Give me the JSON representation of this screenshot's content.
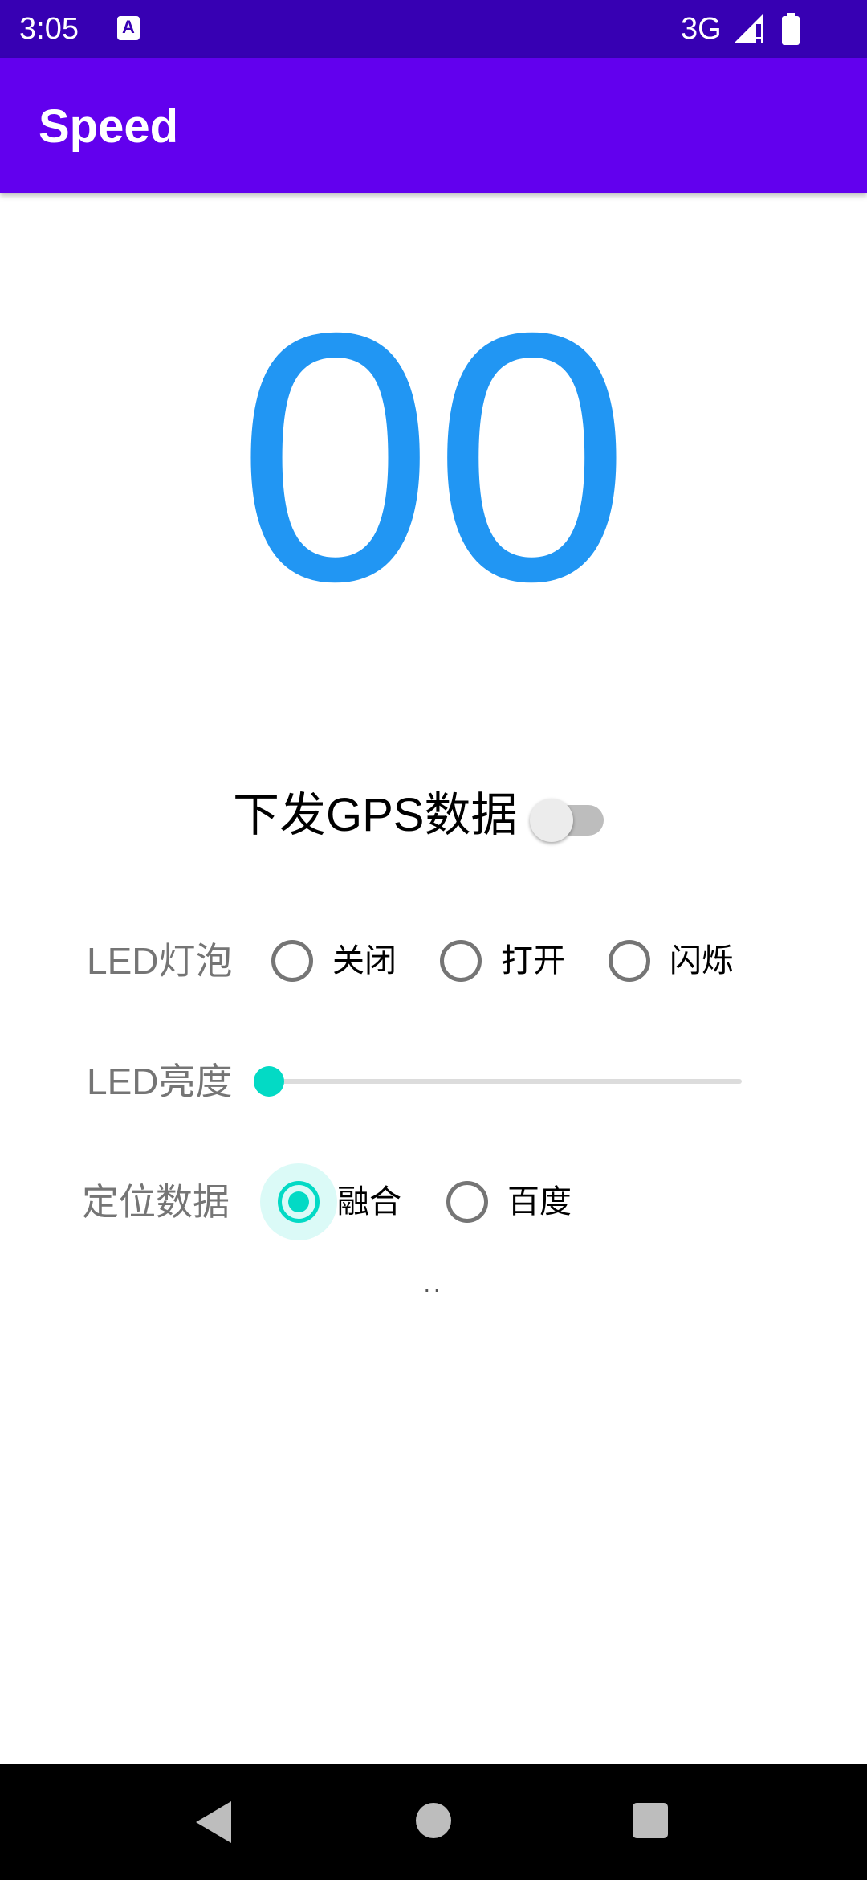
{
  "status_bar": {
    "time": "3:05",
    "notification_icon_letter": "A",
    "network_type": "3G",
    "icons": [
      "notification-icon",
      "signal-icon",
      "battery-icon"
    ]
  },
  "app_bar": {
    "title": "Speed"
  },
  "speed": {
    "value": "00"
  },
  "gps": {
    "label": "下发GPS数据",
    "enabled": false
  },
  "led_bulb": {
    "label": "LED灯泡",
    "options": [
      "关闭",
      "打开",
      "闪烁"
    ],
    "selected": null
  },
  "led_brightness": {
    "label": "LED亮度",
    "value": 0
  },
  "location_data": {
    "label": "定位数据",
    "options": [
      "融合",
      "百度"
    ],
    "selected": "融合"
  },
  "status_text": "..",
  "nav_bar": {
    "icons": [
      "back-icon",
      "home-icon",
      "recents-icon"
    ]
  },
  "colors": {
    "status_bar": "#3700b3",
    "app_bar": "#6200ee",
    "speed": "#2196f3",
    "accent": "#03dac5"
  }
}
